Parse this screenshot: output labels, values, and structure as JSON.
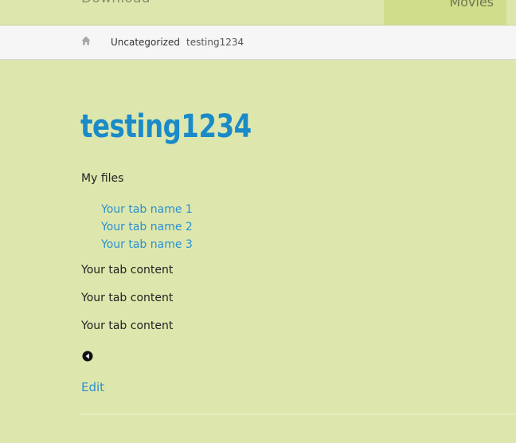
{
  "header": {
    "site_link": "Download",
    "nav_item": "Movies"
  },
  "breadcrumb": {
    "home_icon": "home-icon",
    "category": "Uncategorized",
    "current": "testing1234"
  },
  "page": {
    "title": "testing1234",
    "section_label": "My files",
    "tabs": [
      {
        "label": "Your tab name 1"
      },
      {
        "label": "Your tab name 2"
      },
      {
        "label": "Your tab name 3"
      }
    ],
    "tab_contents": [
      "Your tab content",
      "Your tab content",
      "Your tab content"
    ],
    "back_icon": "circle-left-arrow-icon",
    "edit_label": "Edit"
  },
  "colors": {
    "background": "#dde7ad",
    "link": "#2b90cf",
    "title": "#1a8ac9",
    "breadcrumb_bg": "#f6f6f6"
  }
}
